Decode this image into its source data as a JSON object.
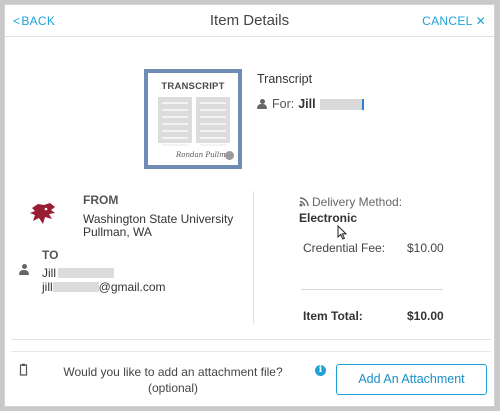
{
  "header": {
    "back_label": "BACK",
    "title": "Item Details",
    "cancel_label": "CANCEL"
  },
  "document": {
    "card_title": "TRANSCRIPT",
    "signature": "Rondan Pullm",
    "name": "Transcript",
    "for_label": "For:",
    "for_name": "Jill"
  },
  "from": {
    "label": "FROM",
    "name_line1": "Washington State University",
    "name_line2": "Pullman, WA"
  },
  "to": {
    "label": "TO",
    "name": "Jill",
    "email_prefix": "jill",
    "email_suffix": "@gmail.com"
  },
  "delivery": {
    "label": "Delivery Method:",
    "value": "Electronic"
  },
  "fees": {
    "credential_fee_label": "Credential Fee:",
    "credential_fee_value": "$10.00",
    "total_label": "Item Total:",
    "total_value": "$10.00"
  },
  "attachment": {
    "question_line1": "Would you like to add an attachment file?",
    "question_line2": "(optional)",
    "info_glyph": "i",
    "button_label": "Add An Attachment"
  },
  "colors": {
    "accent": "#1ea3d8",
    "card_border": "#6e8cb4",
    "wsu_crimson": "#981e32"
  }
}
